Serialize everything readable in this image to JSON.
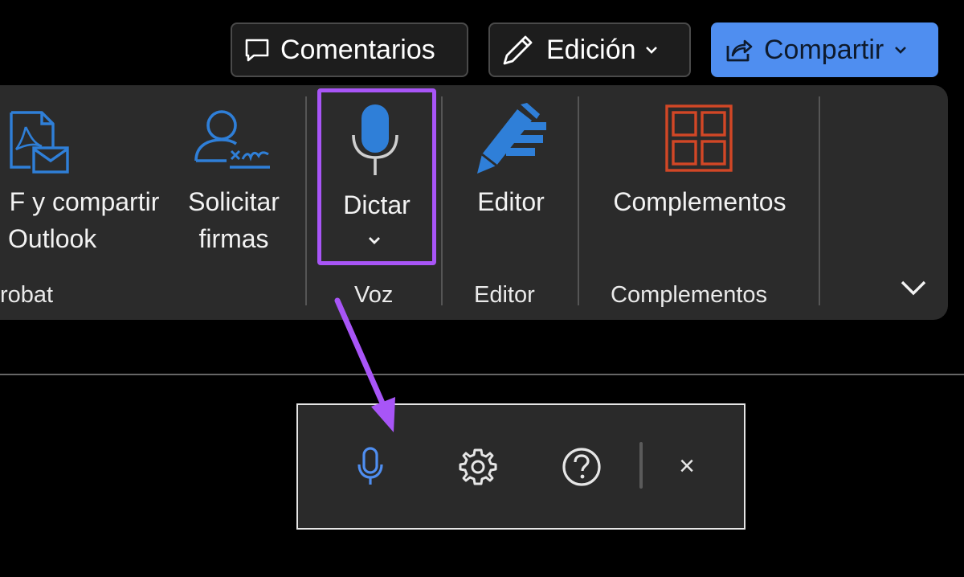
{
  "top_buttons": {
    "comments_label": "Comentarios",
    "edit_label": "Edición",
    "share_label": "Compartir"
  },
  "ribbon": {
    "acrobat": {
      "pdf_share_line1": "F y compartir",
      "pdf_share_line2": "Outlook",
      "request_signatures_line1": "Solicitar",
      "request_signatures_line2": "firmas",
      "group_label": "robat"
    },
    "voice": {
      "dictate_label": "Dictar",
      "group_label": "Voz"
    },
    "editor": {
      "editor_label": "Editor",
      "group_label": "Editor"
    },
    "addins": {
      "addins_label": "Complementos",
      "group_label": "Complementos"
    }
  },
  "dictation_toolbar": {
    "close_label": "×"
  },
  "colors": {
    "accent_blue": "#4f8ef0",
    "mic_blue": "#2f7fd8",
    "highlight_purple": "#a855f7",
    "addins_orange": "#d24726",
    "ribbon_bg": "#2b2b2b"
  }
}
